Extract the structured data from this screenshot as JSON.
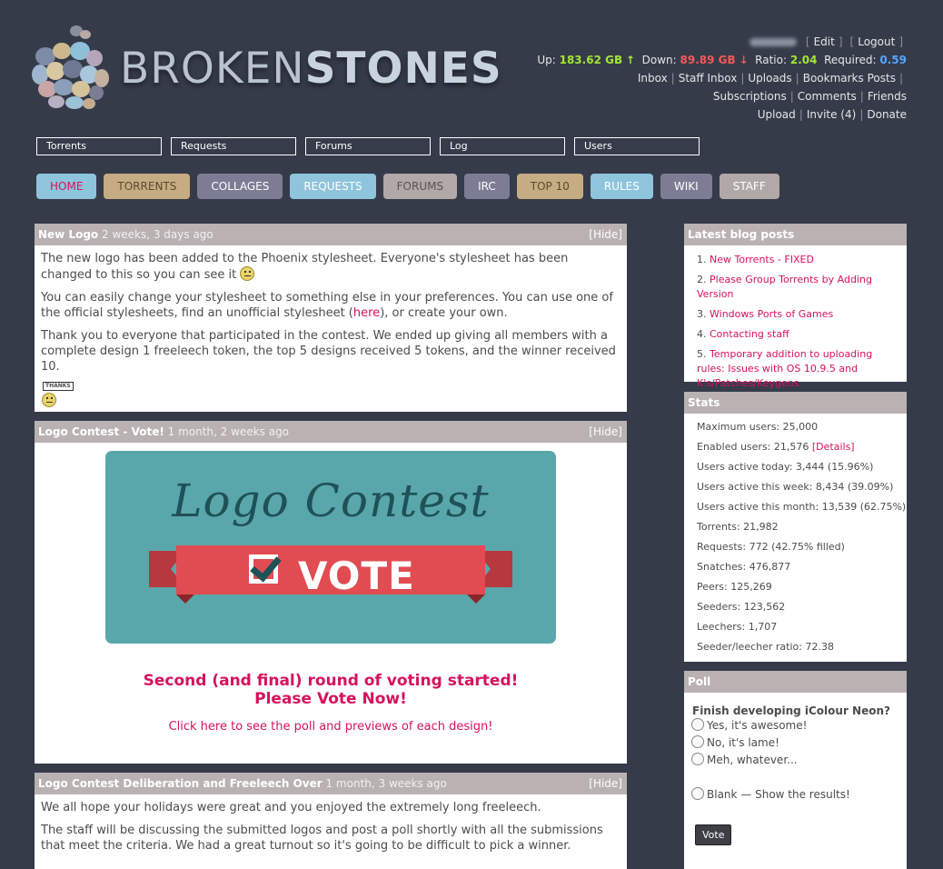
{
  "logo": {
    "text_thin": "BROKEN",
    "text_bold": "STONES"
  },
  "user": {
    "edit": "Edit",
    "logout": "Logout",
    "up_label": "Up:",
    "up_value": "183.62 GB",
    "up_arrow": "↑",
    "down_label": "Down:",
    "down_value": "89.89 GB",
    "down_arrow": "↓",
    "ratio_label": "Ratio:",
    "ratio_value": "2.04",
    "required_label": "Required:",
    "required_value": "0.59",
    "links_row1": [
      "Inbox",
      "Staff Inbox",
      "Uploads",
      "Bookmarks"
    ],
    "posts": "Posts",
    "links_row2": [
      "Subscriptions",
      "Comments",
      "Friends"
    ],
    "links_row3": [
      "Upload",
      "Invite (4)",
      "Donate"
    ]
  },
  "search": {
    "torrents": "Torrents",
    "requests": "Requests",
    "forums": "Forums",
    "log": "Log",
    "users": "Users"
  },
  "menu": [
    {
      "label": "HOME",
      "bg": "#8ec4dc",
      "fg": "#d6125e"
    },
    {
      "label": "TORRENTS",
      "bg": "#c6ac82",
      "fg": "#5a4a30"
    },
    {
      "label": "COLLAGES",
      "bg": "#7d7c95",
      "fg": "#ffffff"
    },
    {
      "label": "REQUESTS",
      "bg": "#8ec4dc",
      "fg": "#ffffff"
    },
    {
      "label": "FORUMS",
      "bg": "#b1a9a8",
      "fg": "#5b5352"
    },
    {
      "label": "IRC",
      "bg": "#7d7c95",
      "fg": "#ffffff"
    },
    {
      "label": "TOP 10",
      "bg": "#c6ac82",
      "fg": "#5a4a30"
    },
    {
      "label": "RULES",
      "bg": "#8ec4dc",
      "fg": "#ffffff"
    },
    {
      "label": "WIKI",
      "bg": "#7d7c95",
      "fg": "#ffffff"
    },
    {
      "label": "STAFF",
      "bg": "#b1a9a8",
      "fg": "#ffffff"
    }
  ],
  "news": [
    {
      "title": "New Logo",
      "date": "2 weeks, 3 days ago",
      "hide": "[Hide]",
      "p1": "The new logo has been added to the Phoenix stylesheet. Everyone's stylesheet has been changed to this so you can see it",
      "p2_a": "You can easily change your stylesheet to something else in your preferences. You can use one of the official stylesheets, find an unofficial stylesheet (",
      "p2_link": "here",
      "p2_b": "), or create your own.",
      "p3": "Thank you to everyone that participated in the contest. We ended up giving all members with a complete design 1 freeleech token, the top 5 designs received 5 tokens, and the winner received 10.",
      "sign_text": "THANKS"
    },
    {
      "title": "Logo Contest - Vote!",
      "date": "1 month, 2 weeks ago",
      "hide": "[Hide]",
      "banner_title": "Logo Contest",
      "banner_vote": "VOTE",
      "head1": "Second (and final) round of voting started!",
      "head2": "Please Vote Now!",
      "link": "Click here to see the poll and previews of each design!"
    },
    {
      "title": "Logo Contest Deliberation and Freeleech Over",
      "date": "1 month, 3 weeks ago",
      "hide": "[Hide]",
      "p1": "We all hope your holidays were great and you enjoyed the extremely long freeleech.",
      "p2": "The staff will be discussing the submitted logos and post a poll shortly with all the submissions that meet the criteria. We had a great turnout so it's going to be difficult to pick a winner."
    }
  ],
  "blog": {
    "title": "Latest blog posts",
    "items": [
      {
        "num": "1.",
        "text": "New Torrents - FIXED"
      },
      {
        "num": "2.",
        "text": "Please Group Torrents by Adding Version"
      },
      {
        "num": "3.",
        "text": "Windows Ports of Games"
      },
      {
        "num": "4.",
        "text": "Contacting staff"
      },
      {
        "num": "5.",
        "text": "Temporary addition to uploading rules: Issues with OS 10.9.5 and K's/Patches/Keygens"
      }
    ]
  },
  "stats": {
    "title": "Stats",
    "max_users": "Maximum users: 25,000",
    "enabled_users": "Enabled users: 21,576",
    "details": "[Details]",
    "rows": [
      "Users active today: 3,444 (15.96%)",
      "Users active this week: 8,434 (39.09%)",
      "Users active this month: 13,539 (62.75%)",
      "Torrents: 21,982",
      "Requests: 772 (42.75% filled)",
      "Snatches: 476,877",
      "Peers: 125,269",
      "Seeders: 123,562",
      "Leechers: 1,707",
      "Seeder/leecher ratio: 72.38"
    ]
  },
  "poll": {
    "title": "Poll",
    "question": "Finish developing iColour Neon?",
    "options": [
      "Yes, it's awesome!",
      "No, it's lame!",
      "Meh, whatever..."
    ],
    "blank": "Blank — Show the results!",
    "vote_button": "Vote"
  }
}
